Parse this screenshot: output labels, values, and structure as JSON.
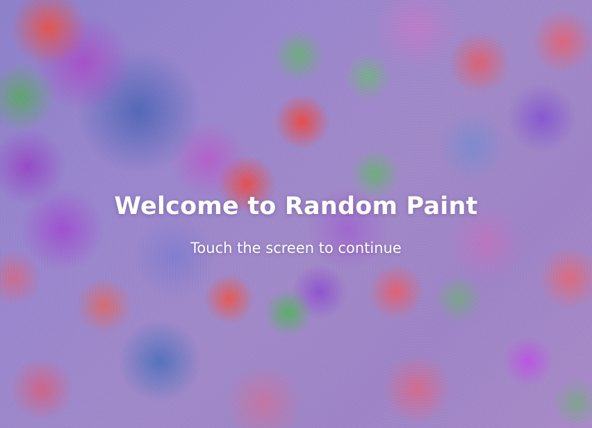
{
  "welcome": {
    "title": "Welcome to Random Paint",
    "prompt": "Touch the screen to continue"
  },
  "colors": {
    "text": "#ffffff",
    "background_base": "#9a86cf",
    "paint_red": "#e7524b",
    "paint_green": "#58aa64",
    "paint_purple": "#aa48c8",
    "paint_blue": "#4662b4"
  }
}
